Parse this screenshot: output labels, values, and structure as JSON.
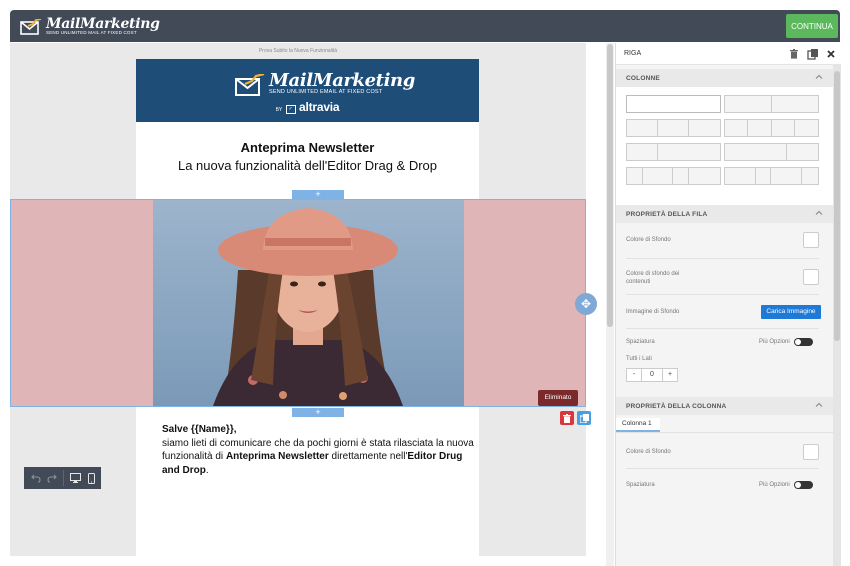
{
  "topbar": {
    "logo_brand": "MailMarketing",
    "logo_tagline": "SEND UNLIMITED MAIL AT FIXED COST",
    "continue_label": "CONTINUA"
  },
  "canvas": {
    "preheader": "Prova Subito la Nuova Funzionalità",
    "email_header": {
      "brand": "MailMarketing",
      "tagline": "SEND UNLIMITED EMAIL AT FIXED COST",
      "by": "BY",
      "altravia": "altravia"
    },
    "heading_line1": "Anteprima Newsletter",
    "heading_line2": "La nuova funzionalità dell'Editor Drag & Drop",
    "add_symbol": "+",
    "delete_tooltip": "Eliminato",
    "body": {
      "greeting": "Salve {{Name}},",
      "p1": "siamo lieti di comunicare che da pochi giorni è stata rilasciata la nuova funzionalità di ",
      "p1_bold": "Anteprima Newsletter",
      "p2": " direttamente nell'",
      "p2_bold": "Editor Drug and Drop",
      "p3": "."
    }
  },
  "panel": {
    "title": "RIGA",
    "sections": {
      "colonne": "COLONNE",
      "proprieta_fila": "PROPRIETÀ DELLA FILA",
      "proprieta_colonna": "PROPRIETÀ DELLA COLONNA"
    },
    "row_props": {
      "bg_color": "Colore di Sfondo",
      "content_bg_color_l1": "Colore di sfondo dei",
      "content_bg_color_l2": "contenuti",
      "bg_image": "Immagine di Sfondo",
      "upload_button": "Carica Immagine",
      "spacing": "Spaziatura",
      "more_options": "Più Opzioni",
      "all_sides": "Tutti i Lati",
      "stepper_minus": "-",
      "stepper_value": "0",
      "stepper_plus": "+"
    },
    "column_tab": "Colonna 1",
    "col_props": {
      "bg_color": "Colore di Sfondo",
      "spacing": "Spaziatura",
      "more_options": "Più Opzioni"
    }
  },
  "colors": {
    "topbar": "#414a56",
    "accent": "#5cb85c",
    "email_header": "#1e4d78",
    "selection": "#7fb3e5",
    "delete": "#d9363e",
    "upload": "#1e7ad6"
  }
}
